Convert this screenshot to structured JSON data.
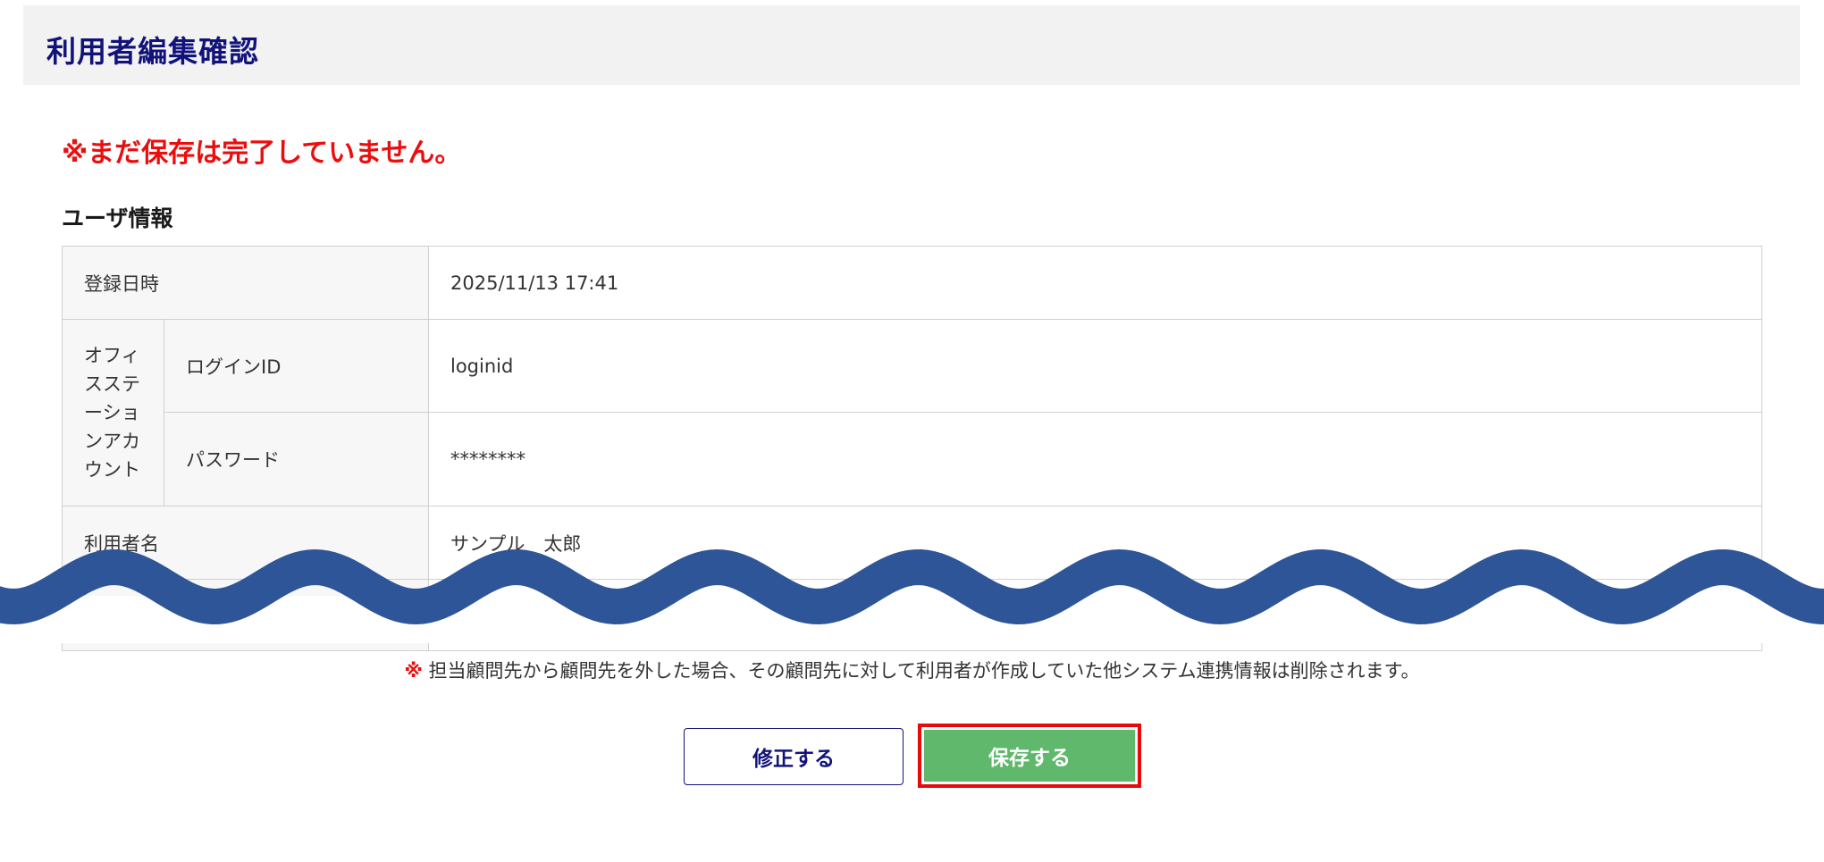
{
  "header": {
    "title": "利用者編集確認"
  },
  "warning": "※まだ保存は完了していません。",
  "section": {
    "title": "ユーザ情報"
  },
  "table": {
    "registered_label": "登録日時",
    "registered_value": "2025/11/13 17:41",
    "group_label": "オフィスステーションアカウント",
    "login_label": "ログインID",
    "login_value": "loginid",
    "password_label": "パスワード",
    "password_value": "********",
    "username_label": "利用者名",
    "username_value": "サンプル　太郎"
  },
  "note": {
    "mark": "※",
    "text": "担当顧問先から顧問先を外した場合、その顧問先に対して利用者が作成していた他システム連携情報は削除されます。"
  },
  "buttons": {
    "edit": "修正する",
    "save": "保存する"
  },
  "colors": {
    "title": "#12137a",
    "warning": "#ea0e0e",
    "wave": "#2e5597",
    "save_button": "#5fb86b",
    "highlight": "#e60b0b"
  }
}
